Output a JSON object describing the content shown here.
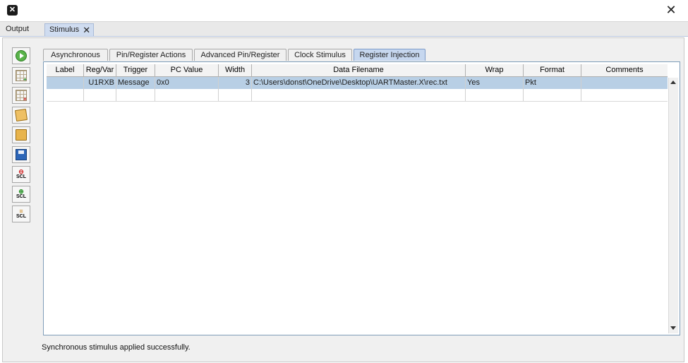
{
  "window": {
    "close_symbol": "✕",
    "app_icon_symbol": "✕"
  },
  "window_tabs": {
    "output_label": "Output",
    "stimulus_label": "Stimulus",
    "stimulus_close": "✕"
  },
  "toolbar": {
    "items": [
      {
        "name": "apply-stimulus-icon"
      },
      {
        "name": "add-row-icon"
      },
      {
        "name": "delete-row-icon"
      },
      {
        "name": "edit-icon"
      },
      {
        "name": "open-folder-icon"
      },
      {
        "name": "save-icon"
      },
      {
        "name": "scl-remove-icon"
      },
      {
        "name": "scl-add-icon"
      },
      {
        "name": "scl-settings-icon"
      }
    ],
    "scl_text": "SCL"
  },
  "tabs": [
    {
      "label": "Asynchronous"
    },
    {
      "label": "Pin/Register Actions"
    },
    {
      "label": "Advanced Pin/Register"
    },
    {
      "label": "Clock Stimulus"
    },
    {
      "label": "Register Injection"
    }
  ],
  "table": {
    "columns": [
      "Label",
      "Reg/Var",
      "Trigger",
      "PC Value",
      "Width",
      "Data Filename",
      "Wrap",
      "Format",
      "Comments"
    ],
    "rows": [
      {
        "label": "",
        "regvar": "U1RXB",
        "trigger": "Message",
        "pc_value": "0x0",
        "width": "3",
        "data_filename": "C:\\Users\\donst\\OneDrive\\Desktop\\UARTMaster.X\\rec.txt",
        "wrap": "Yes",
        "format": "Pkt",
        "comments": ""
      }
    ]
  },
  "status": {
    "message": "Synchronous stimulus applied successfully."
  },
  "colors": {
    "active_tab": "#c6d7ef",
    "selected_row": "#b8cfe5"
  }
}
